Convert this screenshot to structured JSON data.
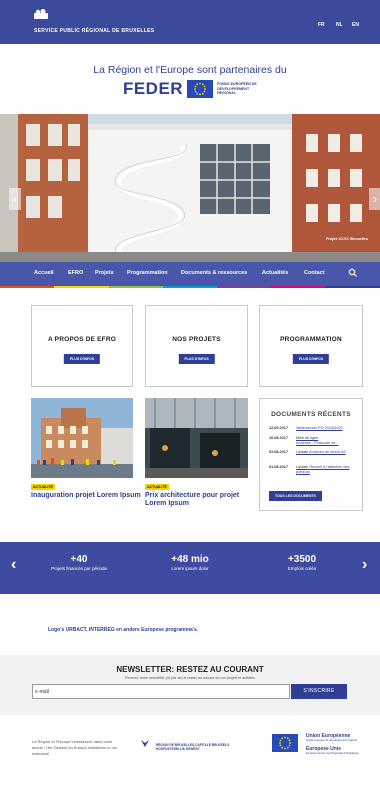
{
  "header": {
    "org_name": "SERVICE PUBLIC RÉGIONAL DE BRUXELLES",
    "languages": [
      "FR",
      "NL",
      "EN"
    ]
  },
  "intro": {
    "headline": "La Région et l'Europe sont partenaires du",
    "feder": "FEDER",
    "feder_subtitle": "FONDS EUROPÉEN DE DÉVELOPPEMENT RÉGIONAL"
  },
  "hero": {
    "caption": "Projet XXXX Bruxelles",
    "prev_icon": "chevron-left-icon",
    "next_icon": "chevron-right-icon"
  },
  "nav": {
    "items": [
      "Accueil",
      "EFRO",
      "Projets",
      "Programmation",
      "Documents & ressources",
      "Actualités",
      "Contact"
    ],
    "search_icon": "search-icon",
    "strip_colors": [
      "#e94e1b",
      "#f5d200",
      "#8bc34a",
      "#00a0d6",
      "#7b3f98",
      "#e5007d",
      "#2e3f95"
    ]
  },
  "cards": [
    {
      "title": "A PROPOS DE EFRO",
      "button": "PLUS D'INFOS"
    },
    {
      "title": "NOS PROJETS",
      "button": "PLUS D'INFOS"
    },
    {
      "title": "PROGRAMMATION",
      "button": "PLUS D'INFOS"
    }
  ],
  "news": [
    {
      "tag": "ACTUALITÉ",
      "title": "Inauguration projet Lorem Ipsum"
    },
    {
      "tag": "ACTUALITÉ",
      "title": "Prix architecture pour projet Lorem Ipsum"
    }
  ],
  "documents": {
    "title": "DOCUMENTS RÉCENTS",
    "items": [
      {
        "date": "12.09.2017",
        "text": "Vademecum PO 2014/2020"
      },
      {
        "date": "10.08.2017",
        "text_plain": "Mise en ligne",
        "text": "Annexes - Protocole de..."
      },
      {
        "date": "02.08.2017",
        "text_plain": "Update",
        "text": "Annexes de check A2"
      },
      {
        "date": "01.08.2017",
        "text_plain": "Update",
        "text": "Recueil à l'attention des porteurs"
      }
    ],
    "button": "TOUS LES DOCUMENTS"
  },
  "stats": {
    "items": [
      {
        "value": "+40",
        "label": "Projets financés par période"
      },
      {
        "value": "+48 mio",
        "label": "Lorem ipsum dolor"
      },
      {
        "value": "+3500",
        "label": "Emplois créés"
      }
    ]
  },
  "logos_link": "Logo's URBACT, INTERREG en andere Europese programma's.",
  "newsletter": {
    "title": "NEWSLETTER: RESTEZ AU COURANT",
    "subtitle": "Recevez notre newsletter (4x par an) et restez au courant de nos projets et activités",
    "placeholder": "e-mail",
    "button": "S'INSCRIRE"
  },
  "footer": {
    "text": "La Région et l'Europe investissent dans votre avenir ! Het Gewest en Europa investeren in uw toekomst!",
    "brs_text": "RÉGION DE BRUXELLES-CAPITALE BRUSSELS HOOFDSTEDELIJK GEWEST",
    "eu_title1": "Union Européenne",
    "eu_sub1": "Fonds européen de développement régional",
    "eu_title2": "Europese Unie",
    "eu_sub2": "Europees Fonds voor Regionale Ontwikkeling"
  }
}
